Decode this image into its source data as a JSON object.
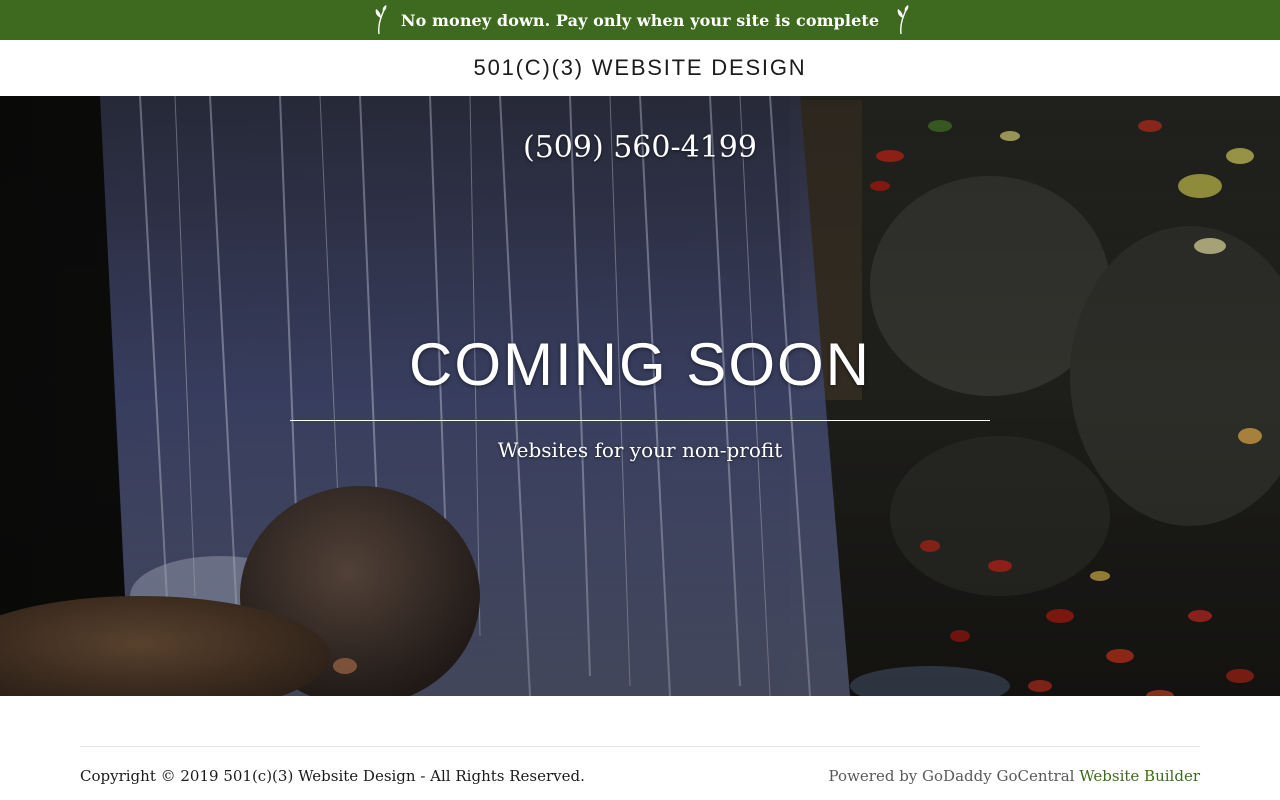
{
  "promo": {
    "text": "No money down. Pay only when your site is complete",
    "icon": "sprout-icon",
    "background": "#3d6a1e"
  },
  "header": {
    "site_title": "501(C)(3) WEBSITE DESIGN"
  },
  "hero": {
    "phone": "(509) 560-4199",
    "headline": "COMING SOON",
    "tagline": "Websites for your non-profit"
  },
  "footer": {
    "copyright": "Copyright © 2019 501(c)(3) Website Design - All Rights Reserved.",
    "powered_prefix": "Powered by GoDaddy GoCentral",
    "powered_link": "Website Builder",
    "link_color": "#3d6a1e"
  }
}
